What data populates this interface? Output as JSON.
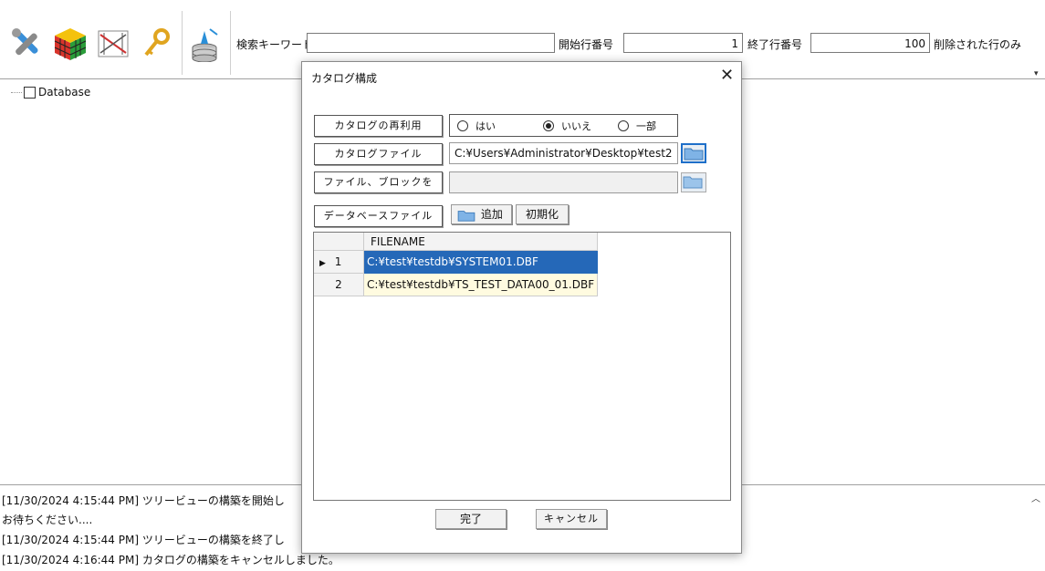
{
  "toolbar": {
    "icons": [
      "tools-icon",
      "rubik-cube-icon",
      "tree-icon",
      "key-icon",
      "database-deploy-icon"
    ],
    "search_label": "検索キーワード",
    "search_value": "",
    "start_label": "開始行番号",
    "start_value": "1",
    "end_label": "終了行番号",
    "end_value": "100",
    "deleted_label": "削除された行のみ"
  },
  "tree": {
    "root_label": "Database"
  },
  "log": {
    "lines": [
      "[11/30/2024 4:15:44 PM] ツリービューの構築を開始し",
      "お待ちください....",
      "[11/30/2024 4:15:44 PM] ツリービューの構築を終了し",
      "[11/30/2024 4:16:44 PM] カタログの構築をキャンセルしました。"
    ]
  },
  "dialog": {
    "title": "カタログ構成",
    "reuse_label": "カタログの再利用",
    "radio_options": [
      "はい",
      "いいえ",
      "一部"
    ],
    "radio_selected": "いいえ",
    "catalog_file_label": "カタログファイル",
    "catalog_file_value": "C:¥Users¥Administrator¥Desktop¥test2",
    "file_block_label": "ファイル、ブロックを",
    "file_block_value": "",
    "db_file_label": "データベースファイル",
    "add_label": "追加",
    "init_label": "初期化",
    "grid": {
      "header": "FILENAME",
      "rows": [
        {
          "num": "1",
          "filename": "C:¥test¥testdb¥SYSTEM01.DBF",
          "selected": true
        },
        {
          "num": "2",
          "filename": "C:¥test¥testdb¥TS_TEST_DATA00_01.DBF",
          "selected": false
        }
      ]
    },
    "ok_label": "完了",
    "cancel_label": "キャンセル"
  }
}
